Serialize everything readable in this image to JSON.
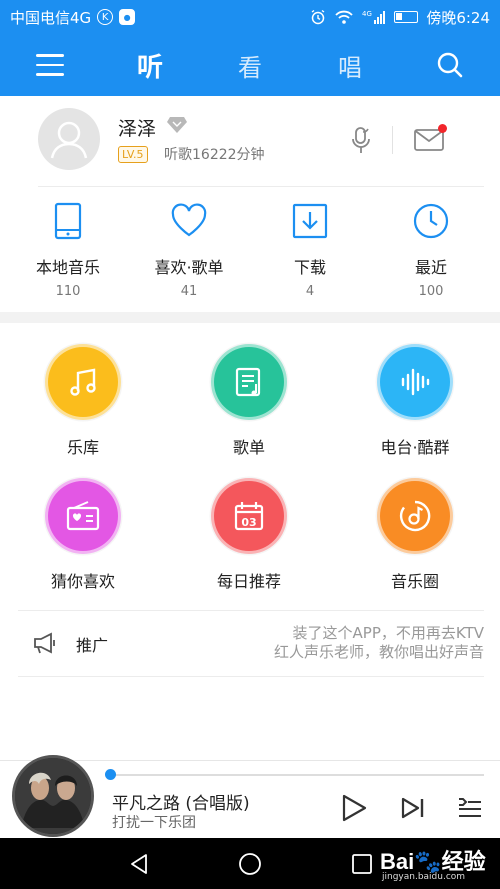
{
  "status_bar": {
    "carrier": "中国电信4G",
    "badge_k": "K",
    "time_text": "傍晚6:24",
    "network": "4G"
  },
  "app_bar": {
    "tabs": [
      {
        "label": "听",
        "active": true
      },
      {
        "label": "看",
        "active": false
      },
      {
        "label": "唱",
        "active": false
      }
    ]
  },
  "profile": {
    "username": "泽泽",
    "level": "LV.5",
    "listen_time": "听歌16222分钟",
    "has_unread_mail": true
  },
  "quick": [
    {
      "label": "本地音乐",
      "count": "110",
      "icon": "phone-icon"
    },
    {
      "label": "喜欢·歌单",
      "count": "41",
      "icon": "heart-icon"
    },
    {
      "label": "下载",
      "count": "4",
      "icon": "download-icon"
    },
    {
      "label": "最近",
      "count": "100",
      "icon": "clock-icon"
    }
  ],
  "grid": [
    {
      "label": "乐库",
      "color": "#fbbd1c",
      "icon": "music-note-icon"
    },
    {
      "label": "歌单",
      "color": "#27c39a",
      "icon": "playlist-icon"
    },
    {
      "label": "电台·酷群",
      "color": "#2cb5f6",
      "icon": "soundwave-icon"
    },
    {
      "label": "猜你喜欢",
      "color": "#e357e4",
      "icon": "radio-heart-icon"
    },
    {
      "label": "每日推荐",
      "color": "#f4575c",
      "icon": "calendar-icon",
      "day": "03"
    },
    {
      "label": "音乐圈",
      "color": "#f98c24",
      "icon": "music-circle-icon"
    }
  ],
  "promo": {
    "label": "推广",
    "line1": "装了这个APP，不用再去KTV",
    "line2": "红人声乐老师，教你唱出好声音"
  },
  "player": {
    "song_title": "平凡之路 (合唱版)",
    "artist": "打扰一下乐团",
    "progress": 0.0
  },
  "watermark": {
    "main": "Bai🐾经验",
    "sub": "jingyan.baidu.com"
  },
  "colors": {
    "accent": "#1c8ff1"
  }
}
